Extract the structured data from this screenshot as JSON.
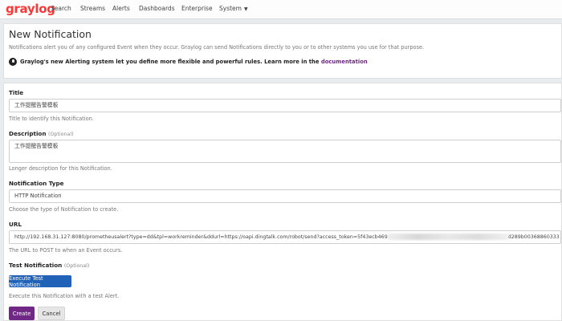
{
  "navbar": {
    "logo": "graylog",
    "items": [
      "Search",
      "Streams",
      "Alerts",
      "Dashboards",
      "Enterprise",
      "System"
    ]
  },
  "header": {
    "title": "New Notification",
    "subtitle": "Notifications alert you of any configured Event when they occur. Graylog can send Notifications directly to you or to other systems you use for that purpose.",
    "alert_text": "Graylog's new Alerting system let you define more flexible and powerful rules. Learn more in the",
    "alert_link": "documentation"
  },
  "form": {
    "title": {
      "label": "Title",
      "value": "工作提醒告警模板",
      "help": "Title to identify this Notification."
    },
    "description": {
      "label": "Description",
      "optional": "(Optional)",
      "value": "工作提醒告警模板",
      "help": "Longer description for this Notification."
    },
    "type": {
      "label": "Notification Type",
      "value": "HTTP Notification",
      "help": "Choose the type of Notification to create."
    },
    "url": {
      "label": "URL",
      "value_start": "http://192.168.31.127:8080/prometheusalert?type=dd&tpl=workreminder&ddurl=https://oapi.dingtalk.com/robot/send?access_token=5f43ecb469",
      "value_end": "d289b00368860333",
      "help": "The URL to POST to when an Event occurs."
    },
    "test": {
      "label": "Test Notification",
      "optional": "(Optional)",
      "button": "Execute Test Notification",
      "help": "Execute this Notification with a test Alert."
    },
    "create_button": "Create",
    "cancel_button": "Cancel"
  },
  "colors": {
    "logo": "#ff3633",
    "primary": "#702785",
    "test_button": "#1f62b8"
  }
}
